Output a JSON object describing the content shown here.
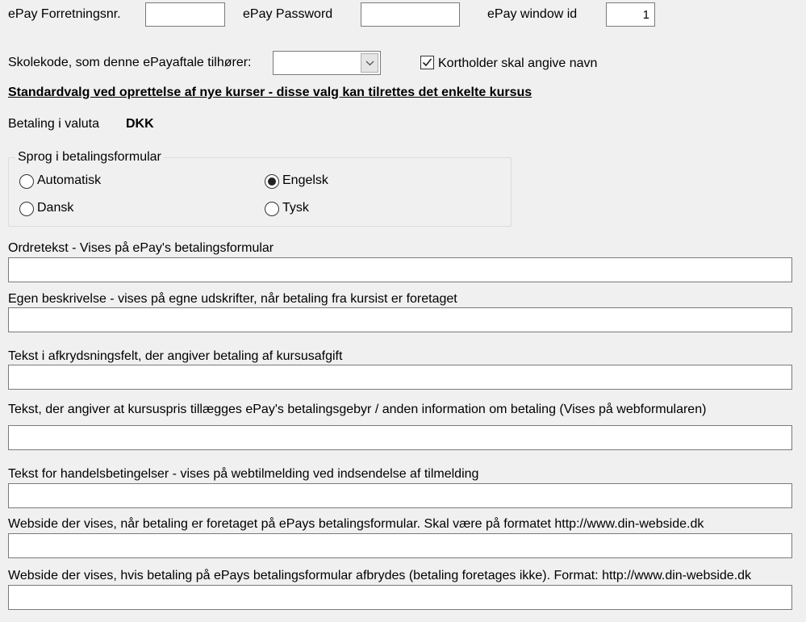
{
  "epay": {
    "merchant_label": "ePay Forretningsnr.",
    "merchant_value": "",
    "password_label": "ePay Password",
    "password_value": "",
    "window_label": "ePay window id",
    "window_value": "1"
  },
  "school": {
    "label": "Skolekode, som denne ePayaftale tilhører:",
    "selected_value": "",
    "cardholder_label": "Kortholder skal angive navn",
    "cardholder_checked": true
  },
  "defaults_heading": "Standardvalg ved oprettelse af nye kurser - disse valg kan tilrettes det enkelte kursus",
  "currency": {
    "label": "Betaling i valuta",
    "value": "DKK"
  },
  "language": {
    "legend": "Sprog i betalingsformular",
    "options": [
      {
        "label": "Automatisk",
        "selected": false
      },
      {
        "label": "Engelsk",
        "selected": true
      },
      {
        "label": "Dansk",
        "selected": false
      },
      {
        "label": "Tysk",
        "selected": false
      }
    ]
  },
  "fields": [
    {
      "label": "Ordretekst - Vises på ePay's betalingsformular",
      "value": ""
    },
    {
      "label": "Egen beskrivelse - vises på egne udskrifter, når betaling fra kursist er foretaget",
      "value": ""
    },
    {
      "label": "Tekst i afkrydsningsfelt, der angiver betaling af kursusafgift",
      "value": ""
    },
    {
      "label": "Tekst, der angiver at kursuspris tillægges ePay's betalingsgebyr / anden information om betaling (Vises på webformularen)",
      "value": ""
    },
    {
      "label": "Tekst for handelsbetingelser - vises på webtilmelding ved indsendelse af tilmelding",
      "value": ""
    },
    {
      "label": "Webside der vises, når betaling er foretaget på ePays betalingsformular. Skal være på formatet http://www.din-webside.dk",
      "value": ""
    },
    {
      "label": "Webside der vises, hvis betaling på ePays betalingsformular afbrydes (betaling foretages ikke). Format: http://www.din-webside.dk",
      "value": ""
    }
  ],
  "icons": {
    "dropdown": "chevron-down-icon",
    "check": "checkmark-icon"
  }
}
